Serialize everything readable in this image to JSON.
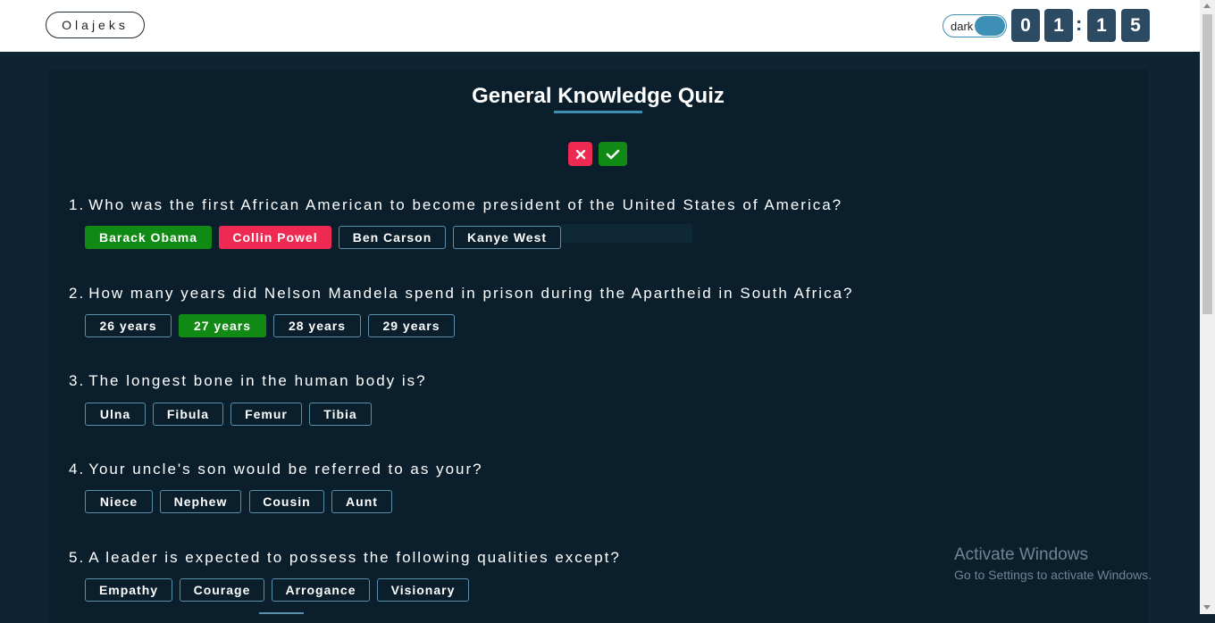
{
  "header": {
    "brand": "Olajeks",
    "theme_toggle_label": "dark",
    "timer": [
      "0",
      "1",
      "1",
      "5"
    ],
    "timer_separator": ":"
  },
  "quiz": {
    "title": "General Knowledge Quiz",
    "questions": [
      {
        "number": "1.",
        "text": "Who was the first African American to become president of the United States of America?",
        "options": [
          "Barack Obama",
          "Collin Powel",
          "Ben Carson",
          "Kanye West"
        ],
        "correct": "Barack Obama",
        "selected_wrong": "Collin Powel"
      },
      {
        "number": "2.",
        "text": "How many years did Nelson Mandela spend in prison during the Apartheid in South Africa?",
        "options": [
          "26 years",
          "27 years",
          "28 years",
          "29 years"
        ],
        "correct": "27 years"
      },
      {
        "number": "3.",
        "text": "The longest bone in the human body is?",
        "options": [
          "Ulna",
          "Fibula",
          "Femur",
          "Tibia"
        ]
      },
      {
        "number": "4.",
        "text": "Your uncle's son would be referred to as your?",
        "options": [
          "Niece",
          "Nephew",
          "Cousin",
          "Aunt"
        ]
      },
      {
        "number": "5.",
        "text": "A leader is expected to possess the following qualities except?",
        "options": [
          "Empathy",
          "Courage",
          "Arrogance",
          "Visionary"
        ]
      }
    ]
  },
  "watermark": {
    "line1": "Activate Windows",
    "line2": "Go to Settings to activate Windows."
  },
  "colors": {
    "correct": "#118a15",
    "wrong": "#ee2a52",
    "accent": "#3e8fb5",
    "background": "#0a1e2b"
  },
  "icons": {
    "close": "close-icon",
    "check": "check-icon"
  }
}
